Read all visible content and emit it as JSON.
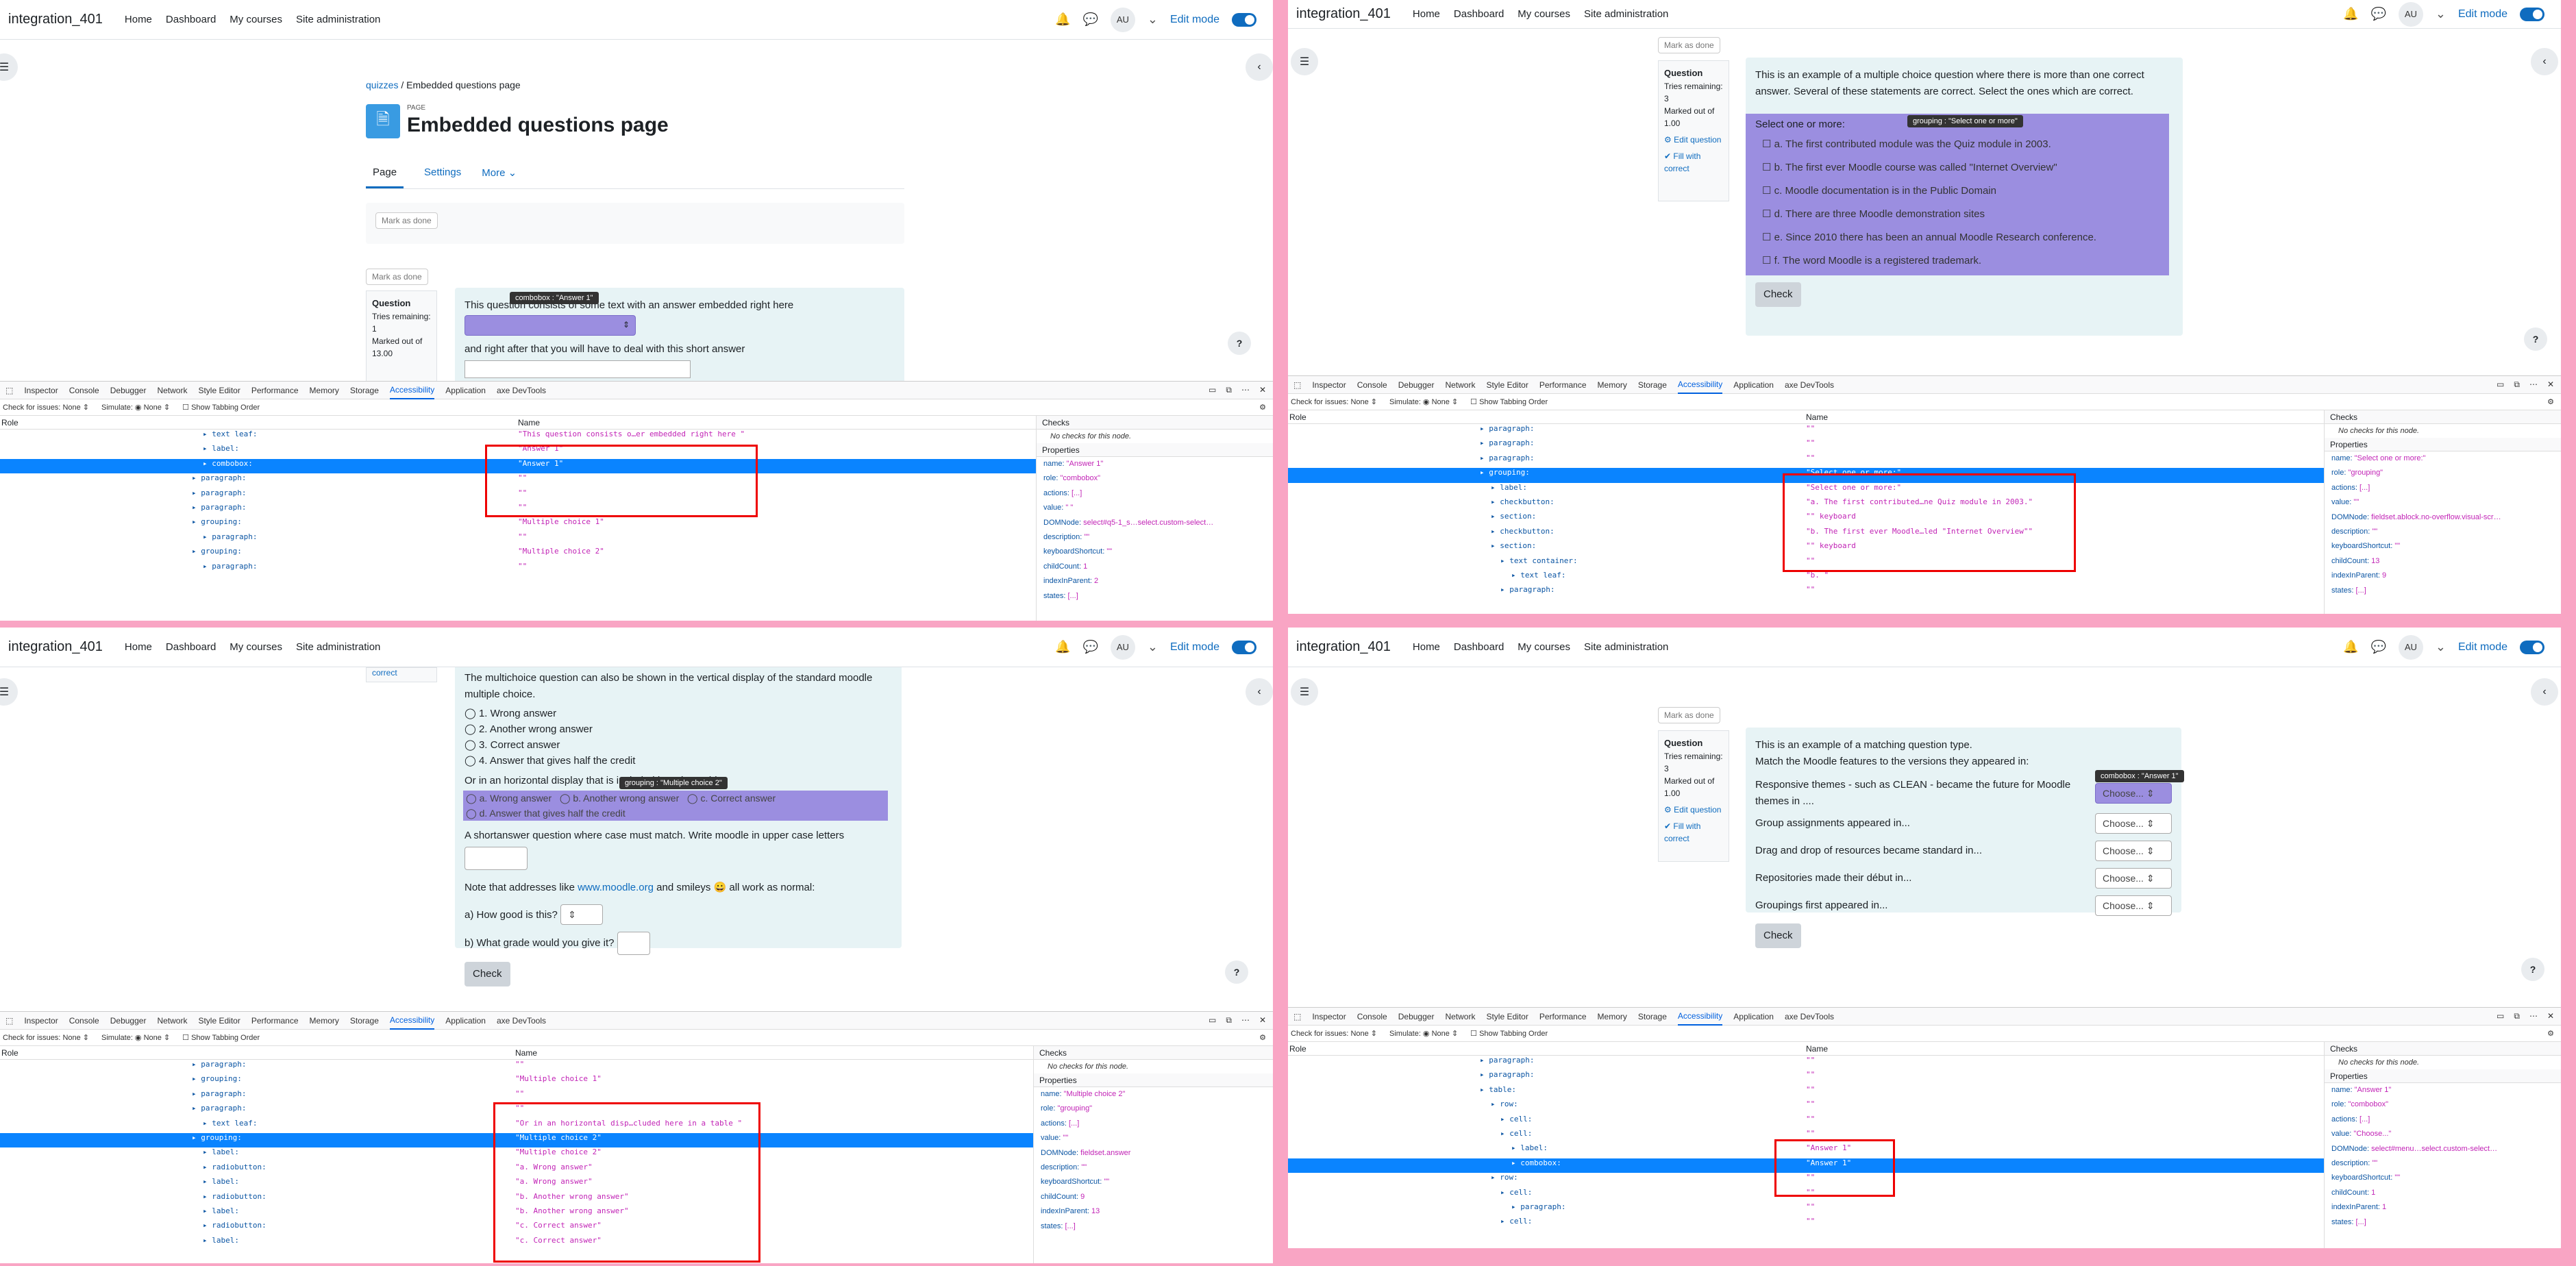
{
  "nav": {
    "brand": "integration_401",
    "links": [
      "Home",
      "Dashboard",
      "My courses",
      "Site administration"
    ],
    "avatar": "AU",
    "edit_mode": "Edit mode"
  },
  "q1": {
    "breadcrumb": [
      "quizzes",
      "/",
      "Embedded questions page"
    ],
    "badge": "PAGE",
    "title": "Embedded questions page",
    "tabs": [
      "Page",
      "Settings",
      "More"
    ],
    "mark_done": "Mark as done",
    "qinfo": {
      "label": "Question",
      "tries": "Tries remaining:",
      "tries_n": "1",
      "marked": "Marked out of",
      "marked_n": "13.00"
    },
    "text1": "This question consists of some text with an answer embedded right here",
    "text2": "and right after that you will have to deal with this short answer",
    "tooltip": "combobox : \"Answer 1\"",
    "tree": [
      {
        "role": "text leaf:",
        "name": "\"This question consists o…er embedded right here \""
      },
      {
        "role": "label:",
        "name": "\"Answer 1\""
      },
      {
        "role": "combobox:",
        "name": "\"Answer 1\""
      },
      {
        "role": "paragraph:",
        "name": "\"\""
      },
      {
        "role": "paragraph:",
        "name": "\"\""
      },
      {
        "role": "paragraph:",
        "name": "\"\""
      },
      {
        "role": "grouping:",
        "name": "\"Multiple choice 1\""
      },
      {
        "role": "paragraph:",
        "name": "\"\""
      },
      {
        "role": "grouping:",
        "name": "\"Multiple choice 2\""
      },
      {
        "role": "paragraph:",
        "name": "\"\""
      }
    ],
    "props": [
      [
        "name:",
        "\"Answer 1\""
      ],
      [
        "role:",
        "\"combobox\""
      ],
      [
        "actions:",
        "[...]"
      ],
      [
        "value:",
        "\" \""
      ],
      [
        "DOMNode:",
        "select#q5-1_s…select.custom-select…"
      ],
      [
        "description:",
        "\"\""
      ],
      [
        "keyboardShortcut:",
        "\"\""
      ],
      [
        "childCount:",
        "1"
      ],
      [
        "indexInParent:",
        "2"
      ],
      [
        "states:",
        "[...]"
      ]
    ]
  },
  "q2": {
    "intro": "This is an example of a multiple choice question where there is more than one correct answer. Several of these statements are correct. Select the ones which are correct.",
    "select": "Select one or more:",
    "tooltip": "grouping : \"Select one or more\"",
    "options": [
      "a.   The first contributed module was the Quiz module in 2003.",
      "b.   The first ever Moodle course was called \"Internet Overview\"",
      "c.   Moodle documentation is in the Public Domain",
      "d.   There are three Moodle demonstration sites",
      "e.   Since 2010 there has been an annual Moodle Research conference.",
      "f.    The word Moodle is a registered trademark."
    ],
    "check": "Check",
    "qinfo": {
      "mark_done": "Mark as done",
      "label": "Question",
      "tries": "Tries remaining:",
      "tries_n": "3",
      "marked": "Marked out of",
      "marked_n": "1.00",
      "edit": "Edit question",
      "fill": "Fill with correct"
    },
    "tree": [
      {
        "role": "paragraph:",
        "name": "\"\""
      },
      {
        "role": "paragraph:",
        "name": "\"\""
      },
      {
        "role": "paragraph:",
        "name": "\"\""
      },
      {
        "role": "grouping:",
        "name": "\"Select one or more:\""
      },
      {
        "role": "label:",
        "name": "\"Select one or more:\""
      },
      {
        "role": "checkbutton:",
        "name": "\"a. The first contributed…ne Quiz module in 2003.\""
      },
      {
        "role": "section:",
        "name": "\"\" keyboard"
      },
      {
        "role": "checkbutton:",
        "name": "\"b. The first ever Moodle…led \"Internet Overview\"\""
      },
      {
        "role": "section:",
        "name": "\"\" keyboard"
      },
      {
        "role": "text container:",
        "name": "\"\""
      },
      {
        "role": "text leaf:",
        "name": "\"b. \""
      },
      {
        "role": "paragraph:",
        "name": "\"\""
      }
    ],
    "props": [
      [
        "name:",
        "\"Select one or more:\""
      ],
      [
        "role:",
        "\"grouping\""
      ],
      [
        "actions:",
        "[...]"
      ],
      [
        "value:",
        "\"\""
      ],
      [
        "DOMNode:",
        "fieldset.ablock.no-overflow.visual-scr…"
      ],
      [
        "description:",
        "\"\""
      ],
      [
        "keyboardShortcut:",
        "\"\""
      ],
      [
        "childCount:",
        "13"
      ],
      [
        "indexInParent:",
        "9"
      ],
      [
        "states:",
        "[...]"
      ]
    ]
  },
  "q3": {
    "fill_correct": "correct",
    "intro": "The multichoice question can also be shown in the vertical display of the standard moodle multiple choice.",
    "radios": [
      "1. Wrong answer",
      "2. Another wrong answer",
      "3. Correct answer",
      "4. Answer that gives half the credit"
    ],
    "horiz": "Or in an horizontal display that is included here in a table",
    "tooltip": "grouping : \"Multiple choice 2\"",
    "hradios": [
      "a. Wrong answer",
      "b. Another wrong answer",
      "c. Correct answer",
      "d. Answer that gives half the credit"
    ],
    "shortanswer": "A shortanswer question where case must match. Write moodle in upper case letters",
    "note_pre": "Note that addresses like ",
    "note_link": "www.moodle.org",
    "note_post": " and smileys 😀  all work as normal:",
    "qa": "a) How good is this?",
    "qb": "b) What grade would you give it?",
    "check": "Check",
    "tree": [
      {
        "role": "paragraph:",
        "name": "\"\""
      },
      {
        "role": "grouping:",
        "name": "\"Multiple choice 1\""
      },
      {
        "role": "paragraph:",
        "name": "\"\""
      },
      {
        "role": "paragraph:",
        "name": "\"\""
      },
      {
        "role": "text leaf:",
        "name": "\"Or in an horizontal disp…cluded here in a table \""
      },
      {
        "role": "grouping:",
        "name": "\"Multiple choice 2\""
      },
      {
        "role": "label:",
        "name": "\"Multiple choice 2\""
      },
      {
        "role": "radiobutton:",
        "name": "\"a. Wrong answer\""
      },
      {
        "role": "label:",
        "name": "\"a. Wrong answer\""
      },
      {
        "role": "radiobutton:",
        "name": "\"b. Another wrong answer\""
      },
      {
        "role": "label:",
        "name": "\"b. Another wrong answer\""
      },
      {
        "role": "radiobutton:",
        "name": "\"c. Correct answer\""
      },
      {
        "role": "label:",
        "name": "\"c. Correct answer\""
      }
    ],
    "props": [
      [
        "name:",
        "\"Multiple choice 2\""
      ],
      [
        "role:",
        "\"grouping\""
      ],
      [
        "actions:",
        "[...]"
      ],
      [
        "value:",
        "\"\""
      ],
      [
        "DOMNode:",
        "fieldset.answer"
      ],
      [
        "description:",
        "\"\""
      ],
      [
        "keyboardShortcut:",
        "\"\""
      ],
      [
        "childCount:",
        "9"
      ],
      [
        "indexInParent:",
        "13"
      ],
      [
        "states:",
        "[...]"
      ]
    ]
  },
  "q4": {
    "intro": "This is an example of a matching question type.",
    "sub": "Match the Moodle features to the versions they appeared in:",
    "tooltip": "combobox : \"Answer 1\"",
    "rows": [
      "Responsive themes - such as CLEAN - became the future for Moodle themes in ....",
      "Group assignments appeared in...",
      "Drag and drop of resources became standard in...",
      "Repositories made their début in...",
      "Groupings first appeared in..."
    ],
    "choose": "Choose...",
    "check": "Check",
    "qinfo": {
      "mark_done": "Mark as done",
      "label": "Question",
      "tries": "Tries remaining:",
      "tries_n": "3",
      "marked": "Marked out of",
      "marked_n": "1.00",
      "edit": "Edit question",
      "fill": "Fill with correct"
    },
    "tree": [
      {
        "role": "paragraph:",
        "name": "\"\""
      },
      {
        "role": "paragraph:",
        "name": "\"\""
      },
      {
        "role": "table:",
        "name": "\"\""
      },
      {
        "role": "row:",
        "name": "\"\""
      },
      {
        "role": "cell:",
        "name": "\"\""
      },
      {
        "role": "cell:",
        "name": "\"\""
      },
      {
        "role": "label:",
        "name": "\"Answer 1\""
      },
      {
        "role": "combobox:",
        "name": "\"Answer 1\""
      },
      {
        "role": "row:",
        "name": "\"\""
      },
      {
        "role": "cell:",
        "name": "\"\""
      },
      {
        "role": "paragraph:",
        "name": "\"\""
      },
      {
        "role": "cell:",
        "name": "\"\""
      }
    ],
    "props": [
      [
        "name:",
        "\"Answer 1\""
      ],
      [
        "role:",
        "\"combobox\""
      ],
      [
        "actions:",
        "[...]"
      ],
      [
        "value:",
        "\"Choose...\""
      ],
      [
        "DOMNode:",
        "select#menu…select.custom-select…"
      ],
      [
        "description:",
        "\"\""
      ],
      [
        "keyboardShortcut:",
        "\"\""
      ],
      [
        "childCount:",
        "1"
      ],
      [
        "indexInParent:",
        "1"
      ],
      [
        "states:",
        "[...]"
      ]
    ]
  },
  "devtools": {
    "tabs": [
      "Inspector",
      "Console",
      "Debugger",
      "Network",
      "Style Editor",
      "Performance",
      "Memory",
      "Storage",
      "Accessibility",
      "Application",
      "axe DevTools"
    ],
    "check_issues": "Check for issues:",
    "none": "None",
    "simulate": "Simulate:",
    "tabbing": "Show Tabbing Order",
    "col_role": "Role",
    "col_name": "Name",
    "checks": "Checks",
    "no_checks": "No checks for this node.",
    "properties": "Properties"
  },
  "colors": {
    "accent": "#0f6cbf",
    "highlight": "#9b8ee0",
    "selection": "#0a84ff",
    "redbox": "#ee0000",
    "bg_pink": "#f9a5c4"
  }
}
